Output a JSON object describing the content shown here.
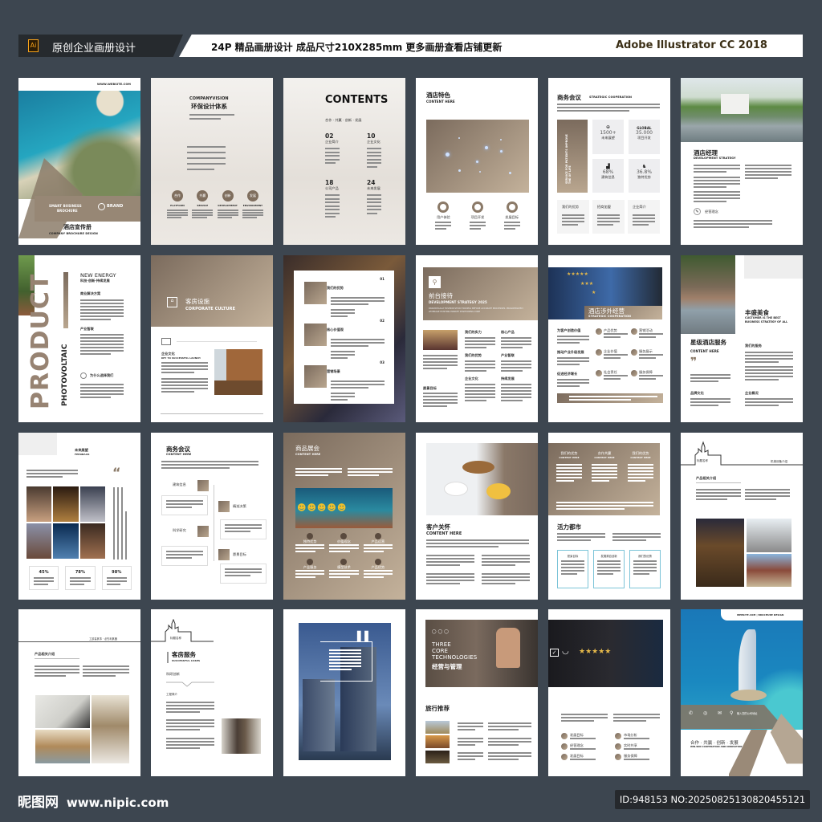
{
  "header": {
    "ai_badge": "Ai",
    "title": "原创企业画册设计",
    "spec": "24P 精品画册设计 成品尺寸210X285mm 更多画册查看店铺更新",
    "software": "Adobe Illustrator CC 2018"
  },
  "footer": {
    "logo": "昵图网",
    "site": "www.nipic.com",
    "id": "ID:948153 NO:20250825130820455121"
  },
  "colors": {
    "background": "#3d4650",
    "accent_tan": "#8b7a68",
    "accent_light": "#c4b29b"
  },
  "p1": {
    "website": "WWW.WEBSITE.COM",
    "tag1": "SMART BUSINESS",
    "tag2": "BROCHURE",
    "brand": "BRAND",
    "title": "酒店宣传册",
    "subtitle": "COMPANY BROCHURE DESIGN"
  },
  "p2": {
    "title_en": "COMPANYVISION",
    "title_cn": "环保设计体系",
    "circles": [
      "合作",
      "共赢",
      "创新",
      "发展"
    ],
    "labels": [
      "PLATFORM",
      "SERVICE",
      "DEVELOPMENT",
      "ENVIRONMENT"
    ]
  },
  "p3": {
    "title": "CONTENTS",
    "motto": "合作 · 共赢 · 创新 · 发展",
    "sections": [
      {
        "num": "02",
        "name": "企业简介"
      },
      {
        "num": "10",
        "name": "企业文化"
      },
      {
        "num": "18",
        "name": "公司产品"
      },
      {
        "num": "24",
        "name": "未来发展"
      }
    ]
  },
  "p4": {
    "title": "酒店特色",
    "subtitle": "CONTENT HERE",
    "items": [
      "用户体验",
      "项目开发",
      "发展目标"
    ]
  },
  "p5": {
    "title": "商务会议",
    "subtitle": "STRATEGIC COOPERATION",
    "vertical": "SERVICE FOR PATIENTS IMPROVE THE OF LIFE",
    "stats": [
      {
        "top": "",
        "value": "1500+",
        "label": "未来展望"
      },
      {
        "top": "GLOBAL",
        "value": "35.000",
        "label": "项目开发"
      },
      {
        "top": "",
        "value": "68%",
        "label": "建筑信息"
      },
      {
        "top": "",
        "value": "36.8%",
        "label": "独特优势"
      }
    ],
    "cards": [
      "我们的优势",
      "招商加盟",
      "企业简介"
    ]
  },
  "p6": {
    "title": "酒店经理",
    "subtitle": "DEVELOPMENT STRATEGY",
    "item": "经营理念"
  },
  "p7": {
    "big": "PRODUCT",
    "vertical": "PHOTOVOLTAIC",
    "title": "NEW ENERGY",
    "motto": "科技·创新·持续发展",
    "h1": "商业解决方案",
    "h2": "产业智联",
    "h3": "为什么选择我们"
  },
  "p8": {
    "title": "客房设施",
    "subtitle": "CORPORATE CULTURE",
    "h1": "企业文化",
    "h1_sub": "KEY TO SUCCESSFUL LAUNCH"
  },
  "p9": {
    "items": [
      {
        "title": "我们的优势",
        "num": "01"
      },
      {
        "title": "核心价值观",
        "num": "02"
      },
      {
        "title": "营销场景",
        "num": "03"
      }
    ]
  },
  "p10": {
    "title": "前台接待",
    "subtitle": "DEVELOPMENT STRATEGY 2025",
    "desc": "DRAMATICALLY FASHION STICKY MODELS BEFORE ACCURATE PROCESSES. PROGRESSIVELY LEVERAGE EXISTING MARKET POSITIONING CORE",
    "items": [
      "我们的实力",
      "核心产品",
      "我们的优势",
      "产业智联",
      "企业文化",
      "持续发展"
    ],
    "goal": "愿景目标"
  },
  "p11": {
    "title": "酒店涉外经营",
    "subtitle": "STRATEGIC COOPERATION",
    "left": [
      "为客户创造价值",
      "推动产业升级发展",
      "促进经济增长"
    ],
    "icons": [
      "产品优势",
      "营销活动",
      "企业价值",
      "服务展示",
      "社会责任",
      "服务保障"
    ]
  },
  "p12": {
    "title": "丰盛美食",
    "sub1": "CUSTOMER IS THE BEST",
    "sub2": "BUSINESS STRATEGY OF ALL",
    "h1": "星级酒店服务",
    "h1_sub": "CONTENT HERE",
    "h2": "我们的服务",
    "h3": "品牌文化",
    "h4": "企业概况"
  },
  "p13": {
    "title": "未来展望",
    "subtitle": "FEEDBACK",
    "stats": [
      "45%",
      "78%",
      "98%"
    ]
  },
  "p14": {
    "title": "商务会议",
    "subtitle": "CONTENT HERE",
    "steps": [
      "建筑信息",
      "精准决策",
      "科学研究",
      "愿景目标"
    ]
  },
  "p15": {
    "title": "商品展会",
    "subtitle": "CONTENT HERE",
    "items": [
      "独特优势",
      "价值观念",
      "产品运营",
      "产业服务",
      "模型技术",
      "产品优势"
    ]
  },
  "p16": {
    "title": "客户关怀",
    "subtitle": "CONTENT HERE"
  },
  "p17": {
    "cols": [
      {
        "title": "我们的优势",
        "sub": "CONTENT HERE"
      },
      {
        "title": "合作共赢",
        "sub": "CONTENT HERE"
      },
      {
        "title": "我们的优势",
        "sub": "CONTENT HERE"
      }
    ],
    "h": "活力都市",
    "cards": [
      "愿景目标",
      "发展源自创新",
      "我们的优势"
    ]
  },
  "p18": {
    "label": "标题名称",
    "right": "机械设备介绍",
    "h": "产品相关介绍"
  },
  "p19": {
    "right": "工欲善其事 · 必先利其器",
    "h": "产品相关介绍"
  },
  "p20": {
    "label": "标题名称",
    "title": "客房服务",
    "subtitle": "SUCCESSFUL CASES",
    "h1": "科研创新",
    "h2": "工程简介"
  },
  "p22": {
    "l1": "THREE",
    "l2": "CORE",
    "l3": "TECHNOLOGIES",
    "cn": "经营与管理",
    "h": "旅行推荐"
  },
  "p23": {
    "items": [
      "发展目标",
      "市场分析",
      "经营理念",
      "实时共享",
      "发展目标",
      "服务保障"
    ]
  },
  "p24": {
    "top": "WEBSITE.COM  |  BROCHURE DESIGN",
    "address": "输入您的公司地址",
    "motto": "合作 · 共赢 · 创新 · 发展",
    "motto_sub": "WIN-WIN COOPERATION AND INNOVATION"
  }
}
